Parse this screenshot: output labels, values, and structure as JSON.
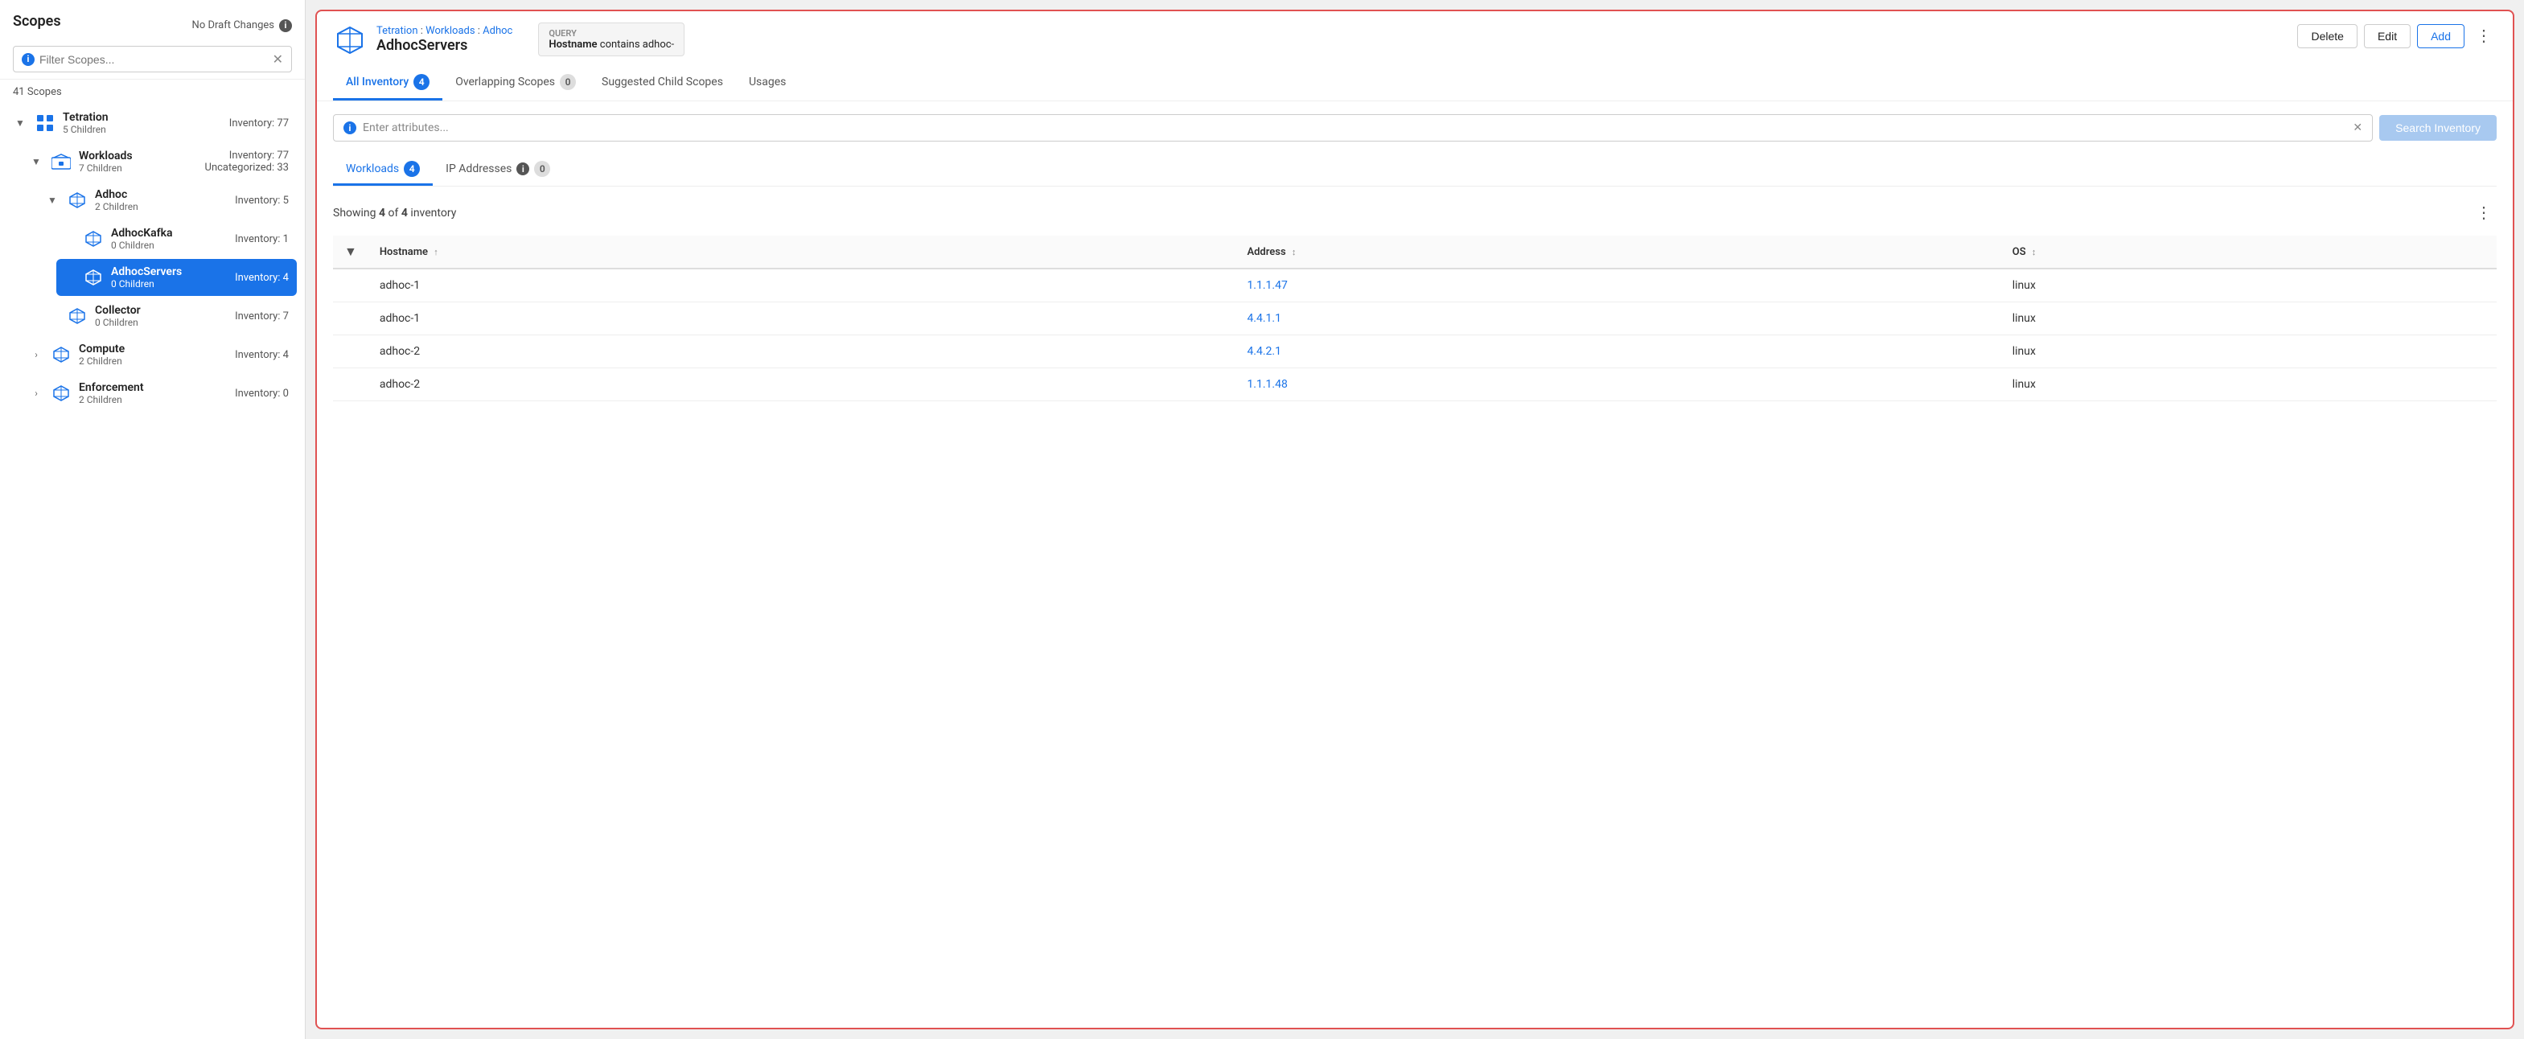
{
  "sidebar": {
    "title": "Scopes",
    "draft_status": "No Draft Changes",
    "filter_placeholder": "Filter Scopes...",
    "scope_count": "41 Scopes",
    "items": [
      {
        "id": "tetration",
        "name": "Tetration",
        "children_count": "5 Children",
        "inventory": "Inventory: 77",
        "level": 0,
        "expanded": true,
        "type": "grid"
      },
      {
        "id": "workloads",
        "name": "Workloads",
        "children_count": "7 Children",
        "inventory": "Inventory: 77",
        "inventory2": "Uncategorized: 33",
        "level": 1,
        "expanded": true,
        "type": "cube"
      },
      {
        "id": "adhoc",
        "name": "Adhoc",
        "children_count": "2 Children",
        "inventory": "Inventory: 5",
        "level": 2,
        "expanded": true,
        "type": "cube"
      },
      {
        "id": "adhockafka",
        "name": "AdhocKafka",
        "children_count": "0 Children",
        "inventory": "Inventory: 1",
        "level": 3,
        "expanded": false,
        "type": "cube"
      },
      {
        "id": "adhocservers",
        "name": "AdhocServers",
        "children_count": "0 Children",
        "inventory": "Inventory: 4",
        "level": 3,
        "expanded": false,
        "type": "cube",
        "active": true
      },
      {
        "id": "collector",
        "name": "Collector",
        "children_count": "0 Children",
        "inventory": "Inventory: 7",
        "level": 2,
        "expanded": false,
        "type": "cube"
      },
      {
        "id": "compute",
        "name": "Compute",
        "children_count": "2 Children",
        "inventory": "Inventory: 4",
        "level": 1,
        "expanded": false,
        "type": "cube"
      },
      {
        "id": "enforcement",
        "name": "Enforcement",
        "children_count": "2 Children",
        "inventory": "Inventory: 0",
        "level": 1,
        "expanded": false,
        "type": "cube"
      }
    ]
  },
  "main": {
    "breadcrumb": [
      "Tetration",
      "Workloads",
      "Adhoc"
    ],
    "scope_name": "AdhocServers",
    "query_label": "Query",
    "query_text": "Hostname contains adhoc-",
    "query_hostname_label": "Hostname",
    "query_contains": "contains",
    "query_value": "adhoc-",
    "actions": {
      "delete": "Delete",
      "edit": "Edit",
      "add": "Add"
    },
    "tabs": [
      {
        "id": "all_inventory",
        "label": "All Inventory",
        "badge": "4",
        "badge_type": "blue",
        "active": true
      },
      {
        "id": "overlapping_scopes",
        "label": "Overlapping Scopes",
        "badge": "0",
        "badge_type": "gray",
        "active": false
      },
      {
        "id": "suggested_child_scopes",
        "label": "Suggested Child Scopes",
        "badge": null,
        "active": false
      },
      {
        "id": "usages",
        "label": "Usages",
        "badge": null,
        "active": false
      }
    ],
    "search": {
      "placeholder": "Enter attributes...",
      "button_label": "Search Inventory"
    },
    "sub_tabs": [
      {
        "id": "workloads",
        "label": "Workloads",
        "badge": "4",
        "badge_type": "blue",
        "active": true
      },
      {
        "id": "ip_addresses",
        "label": "IP Addresses",
        "badge": "0",
        "badge_type": "gray",
        "active": false
      }
    ],
    "showing_text": "Showing",
    "showing_count": "4",
    "showing_of": "of",
    "showing_total": "4",
    "showing_suffix": "inventory",
    "table": {
      "columns": [
        {
          "id": "filter",
          "label": ""
        },
        {
          "id": "hostname",
          "label": "Hostname",
          "sort": "asc"
        },
        {
          "id": "address",
          "label": "Address",
          "sort": "both"
        },
        {
          "id": "os",
          "label": "OS",
          "sort": "both"
        }
      ],
      "rows": [
        {
          "hostname": "adhoc-1",
          "address": "1.1.1.47",
          "os": "linux"
        },
        {
          "hostname": "adhoc-1",
          "address": "4.4.1.1",
          "os": "linux"
        },
        {
          "hostname": "adhoc-2",
          "address": "4.4.2.1",
          "os": "linux"
        },
        {
          "hostname": "adhoc-2",
          "address": "1.1.1.48",
          "os": "linux"
        }
      ]
    }
  }
}
